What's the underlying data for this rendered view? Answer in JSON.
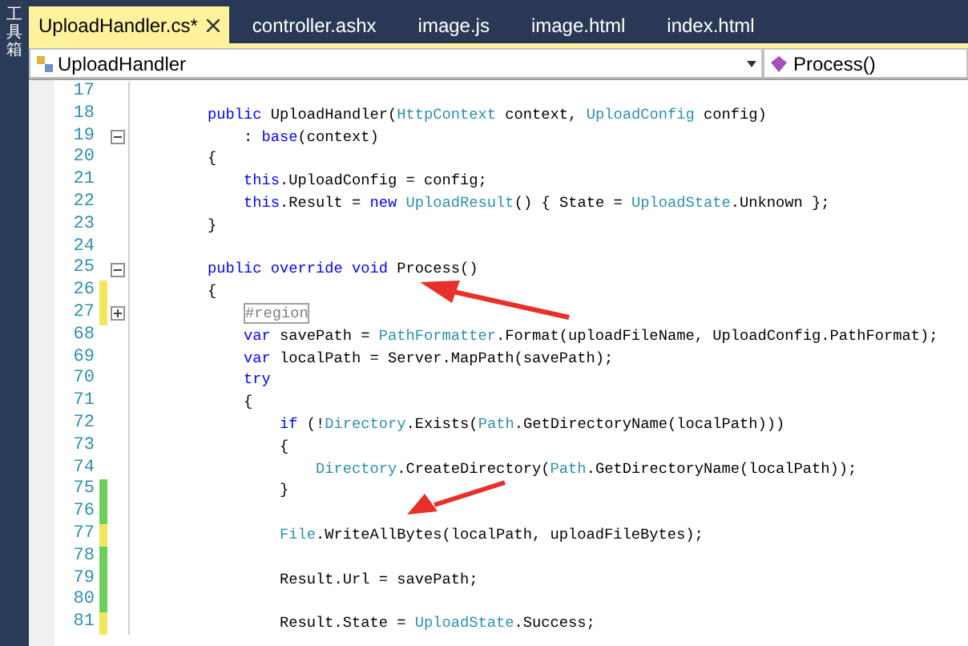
{
  "sidebar": {
    "label": "工具箱"
  },
  "tabs": [
    {
      "label": "UploadHandler.cs*",
      "selected": true,
      "closable": true
    },
    {
      "label": "controller.ashx",
      "selected": false,
      "closable": false
    },
    {
      "label": "image.js",
      "selected": false,
      "closable": false
    },
    {
      "label": "image.html",
      "selected": false,
      "closable": false
    },
    {
      "label": "index.html",
      "selected": false,
      "closable": false
    }
  ],
  "navigation": {
    "type_dropdown": "UploadHandler",
    "member_dropdown": "Process()"
  },
  "editor": {
    "lines": [
      {
        "number": "17",
        "changed": false
      },
      {
        "number": "18",
        "changed": false,
        "tokens": [
          {
            "text": "    public",
            "kind": "keyword"
          },
          {
            "text": " UploadHandler(",
            "kind": "plain"
          },
          {
            "text": "HttpContext",
            "kind": "type"
          },
          {
            "text": " context, ",
            "kind": "plain"
          },
          {
            "text": "UploadConfig",
            "kind": "type"
          },
          {
            "text": " config)",
            "kind": "plain"
          }
        ]
      },
      {
        "number": "19",
        "changed": false,
        "collapsed": false,
        "tokens": [
          {
            "text": "        :",
            "kind": "plain"
          },
          {
            "text": " base",
            "kind": "keyword"
          },
          {
            "text": "(context)",
            "kind": "plain"
          }
        ]
      },
      {
        "number": "20",
        "changed": false,
        "tokens": [
          {
            "text": "    {",
            "kind": "plain"
          }
        ]
      },
      {
        "number": "21",
        "changed": false,
        "tokens": [
          {
            "text": "        this",
            "kind": "keyword"
          },
          {
            "text": ".UploadConfig = config;",
            "kind": "plain"
          }
        ]
      },
      {
        "number": "22",
        "changed": false,
        "tokens": [
          {
            "text": "        this",
            "kind": "keyword"
          },
          {
            "text": ".Result = ",
            "kind": "plain"
          },
          {
            "text": "new",
            "kind": "keyword"
          },
          {
            "text": " UploadResult",
            "kind": "type"
          },
          {
            "text": "() { State = ",
            "kind": "plain"
          },
          {
            "text": "UploadState",
            "kind": "type"
          },
          {
            "text": ".Unknown };",
            "kind": "plain"
          }
        ]
      },
      {
        "number": "23",
        "changed": false,
        "tokens": [
          {
            "text": "    }",
            "kind": "plain"
          }
        ]
      },
      {
        "number": "24",
        "changed": false
      },
      {
        "number": "25",
        "changed": false,
        "collapsed": false,
        "tokens": [
          {
            "text": "    public override void",
            "kind": "keyword"
          },
          {
            "text": " Process()",
            "kind": "plain"
          }
        ]
      },
      {
        "number": "26",
        "changed": true,
        "saved": false,
        "tokens": [
          {
            "text": "    {",
            "kind": "plain"
          }
        ]
      },
      {
        "number": "27",
        "changed": true,
        "saved": false,
        "collapsed": true,
        "tokens": [
          {
            "text": "#region",
            "kind": "region"
          }
        ]
      },
      {
        "number": "68",
        "changed": false,
        "tokens": [
          {
            "text": "        var",
            "kind": "keyword"
          },
          {
            "text": " savePath = ",
            "kind": "plain"
          },
          {
            "text": "PathFormatter",
            "kind": "type"
          },
          {
            "text": ".Format(uploadFileName, UploadConfig.PathFormat);",
            "kind": "plain"
          }
        ]
      },
      {
        "number": "69",
        "changed": false,
        "tokens": [
          {
            "text": "        var",
            "kind": "keyword"
          },
          {
            "text": " localPath = Server.MapPath(savePath);",
            "kind": "plain"
          }
        ]
      },
      {
        "number": "70",
        "changed": false,
        "tokens": [
          {
            "text": "        try",
            "kind": "keyword"
          }
        ]
      },
      {
        "number": "71",
        "changed": false,
        "tokens": [
          {
            "text": "        {",
            "kind": "plain"
          }
        ]
      },
      {
        "number": "72",
        "changed": false,
        "tokens": [
          {
            "text": "            if",
            "kind": "keyword"
          },
          {
            "text": " (!",
            "kind": "plain"
          },
          {
            "text": "Directory",
            "kind": "type"
          },
          {
            "text": ".Exists(",
            "kind": "plain"
          },
          {
            "text": "Path",
            "kind": "type"
          },
          {
            "text": ".GetDirectoryName(localPath)))",
            "kind": "plain"
          }
        ]
      },
      {
        "number": "73",
        "changed": false,
        "tokens": [
          {
            "text": "            {",
            "kind": "plain"
          }
        ]
      },
      {
        "number": "74",
        "changed": false,
        "tokens": [
          {
            "text": "                Directory",
            "kind": "type"
          },
          {
            "text": ".CreateDirectory(",
            "kind": "plain"
          },
          {
            "text": "Path",
            "kind": "type"
          },
          {
            "text": ".GetDirectoryName(localPath));",
            "kind": "plain"
          }
        ]
      },
      {
        "number": "75",
        "changed": true,
        "saved": true,
        "tokens": [
          {
            "text": "            }",
            "kind": "plain"
          }
        ]
      },
      {
        "number": "76",
        "changed": true,
        "saved": true
      },
      {
        "number": "77",
        "changed": true,
        "saved": false,
        "tokens": [
          {
            "text": "            File",
            "kind": "type"
          },
          {
            "text": ".WriteAllBytes(localPath, uploadFileBytes);",
            "kind": "plain"
          }
        ]
      },
      {
        "number": "78",
        "changed": true,
        "saved": true
      },
      {
        "number": "79",
        "changed": true,
        "saved": true,
        "tokens": [
          {
            "text": "            Result.Url = savePath;",
            "kind": "plain"
          }
        ]
      },
      {
        "number": "80",
        "changed": true,
        "saved": true
      },
      {
        "number": "81",
        "changed": true,
        "saved": false,
        "tokens": [
          {
            "text": "            Result.State = ",
            "kind": "plain"
          },
          {
            "text": "UploadState",
            "kind": "type"
          },
          {
            "text": ".Success;",
            "kind": "plain"
          }
        ]
      }
    ]
  }
}
